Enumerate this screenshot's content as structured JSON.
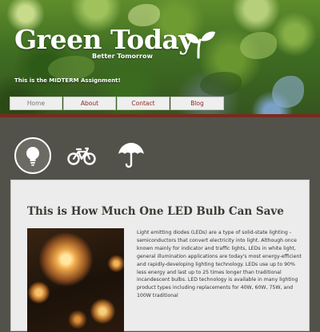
{
  "header": {
    "title": "Green Today",
    "tagline": "Better Tomorrow",
    "note": "This is the MIDTERM Assignment!"
  },
  "nav": {
    "items": [
      {
        "label": "Home"
      },
      {
        "label": "About"
      },
      {
        "label": "Contact"
      },
      {
        "label": "Blog"
      }
    ]
  },
  "icons": [
    "lightbulb-icon",
    "bicycle-icon",
    "umbrella-icon"
  ],
  "article": {
    "title": "This is How Much One LED Bulb Can Save",
    "body": "Light emitting diodes (LEDs) are a type of solid-state lighting - semiconductors that convert electricity into light. Although once known mainly for indicator and traffic lights, LEDs in white light, general illumination applications are today's most energy-efficient and rapidly-developing lighting technology. LEDs use up to 90% less energy and last up to 25 times longer than traditional incandescent bulbs. LED technology is available in many lighting product types including replacements for 40W, 60W, 75W, and 100W traditional"
  },
  "colors": {
    "page_bg": "#52524a",
    "accent": "#7a2a1e",
    "nav_text": "#8b2a24",
    "card_bg": "#ececec"
  }
}
